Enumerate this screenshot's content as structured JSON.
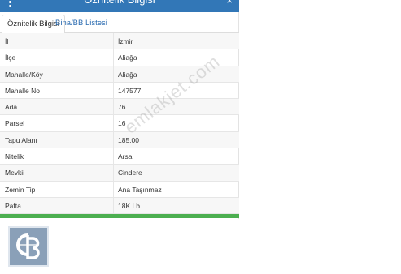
{
  "window": {
    "title": "Öznitelik Bilgisi",
    "close_glyph": "×",
    "menu_icon": "kebab-menu-icon"
  },
  "tabs": [
    {
      "label": "Öznitelik Bilgisi",
      "active": true
    },
    {
      "label": "Bina/BB Listesi",
      "active": false
    }
  ],
  "rows": [
    {
      "key": "İl",
      "value": "İzmir"
    },
    {
      "key": "İlçe",
      "value": "Aliağa"
    },
    {
      "key": "Mahalle/Köy",
      "value": "Aliağa"
    },
    {
      "key": "Mahalle No",
      "value": "147577"
    },
    {
      "key": "Ada",
      "value": "76"
    },
    {
      "key": "Parsel",
      "value": "16"
    },
    {
      "key": "Tapu Alanı",
      "value": "185,00"
    },
    {
      "key": "Nitelik",
      "value": "Arsa"
    },
    {
      "key": "Mevkii",
      "value": "Cindere"
    },
    {
      "key": "Zemin Tip",
      "value": "Ana Taşınmaz"
    },
    {
      "key": "Pafta",
      "value": "18K.I.b"
    }
  ],
  "watermark": "emlakjet.com",
  "logo": {
    "icon": "coldwell-banker-logo",
    "text": "CB"
  },
  "colors": {
    "titlebar": "#3277b7",
    "accent_green": "#4caf50",
    "tab_link": "#2a6bb0"
  }
}
